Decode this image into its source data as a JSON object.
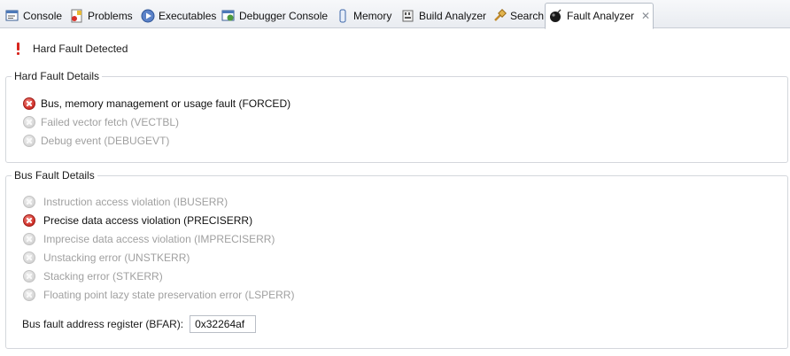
{
  "tabs": [
    {
      "label": "Console",
      "icon": "console-icon"
    },
    {
      "label": "Problems",
      "icon": "problems-icon"
    },
    {
      "label": "Executables",
      "icon": "executables-icon"
    },
    {
      "label": "Debugger Console",
      "icon": "debugger-console-icon"
    },
    {
      "label": "Memory",
      "icon": "memory-icon"
    },
    {
      "label": "Build Analyzer",
      "icon": "build-analyzer-icon"
    },
    {
      "label": "Search",
      "icon": "search-icon"
    },
    {
      "label": "Fault Analyzer",
      "icon": "fault-analyzer-icon",
      "active": true,
      "close": "✕"
    }
  ],
  "header": {
    "title": "Hard Fault Detected"
  },
  "hard_fault": {
    "title": "Hard Fault Details",
    "items": [
      {
        "label": "Bus, memory management or usage fault (FORCED)",
        "active": true
      },
      {
        "label": "Failed vector fetch (VECTBL)",
        "active": false
      },
      {
        "label": "Debug event (DEBUGEVT)",
        "active": false
      }
    ]
  },
  "bus_fault": {
    "title": "Bus Fault Details",
    "items": [
      {
        "label": "Instruction access violation (IBUSERR)",
        "active": false
      },
      {
        "label": "Precise data access violation (PRECISERR)",
        "active": true
      },
      {
        "label": "Imprecise data access violation (IMPRECISERR)",
        "active": false
      },
      {
        "label": "Unstacking error (UNSTKERR)",
        "active": false
      },
      {
        "label": "Stacking error (STKERR)",
        "active": false
      },
      {
        "label": "Floating point lazy state preservation error (LSPERR)",
        "active": false
      }
    ],
    "bfar_label": "Bus fault address register (BFAR):",
    "bfar_value": "0x32264af"
  },
  "colors": {
    "active_status": "#d2322b",
    "inactive_status": "#d6d6d6"
  }
}
